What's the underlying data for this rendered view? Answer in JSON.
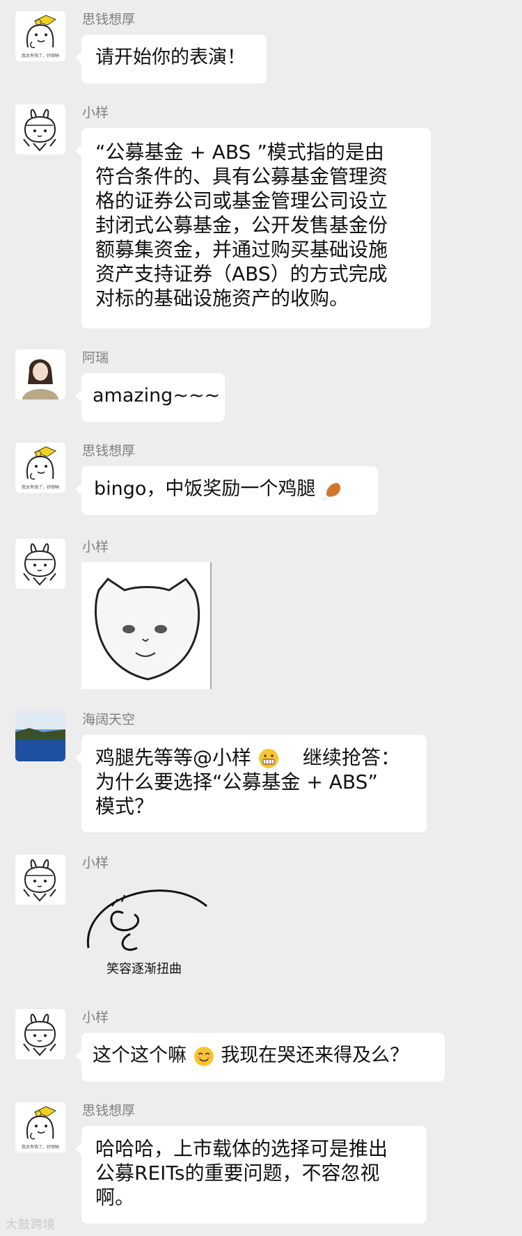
{
  "messages": [
    {
      "sender": "思钱想厚",
      "text": "请开始你的表演！"
    },
    {
      "sender": "小样",
      "lines": [
        "“公募基金 + ABS ”模式指的是由",
        "符合条件的、具有公募基金管理资",
        "格的证券公司或基金管理公司设立",
        "封闭式公募基金，公开发售基金份",
        "额募集资金，并通过购买基础设施",
        "资产支持证券（ABS）的方式完成",
        "对标的基础设施资产的收购。"
      ]
    },
    {
      "sender": "阿瑞",
      "text": "amazing~~~"
    },
    {
      "sender": "思钱想厚",
      "text": "bingo，中饭奖励一个鸡腿",
      "emoji": "chicken-leg-emoji"
    },
    {
      "sender": "小样",
      "sticker": "cat-face-sticker"
    },
    {
      "sender": "海阔天空",
      "lines": [
        "鸡腿先等等@小样",
        "继续抢答：",
        "为什么要选择“公募基金 + ABS”",
        "模式？"
      ],
      "emoji": "grimace-emoji"
    },
    {
      "sender": "小样",
      "sticker": "twisted-smile-sticker",
      "sticker_caption": "笑容逐渐扭曲"
    },
    {
      "sender": "小样",
      "text_before": "这个这个嘛",
      "text_after": "我现在哭还来得及么？",
      "emoji": "smirk-emoji"
    },
    {
      "sender": "思钱想厚",
      "lines": [
        "哈哈哈，上市载体的选择可是推出",
        "公募REITs的重要问题，不容忽视",
        "啊。"
      ]
    }
  ],
  "avatar_caption": "我太有钱了，好烦呐",
  "watermark": "大鼓跨境"
}
